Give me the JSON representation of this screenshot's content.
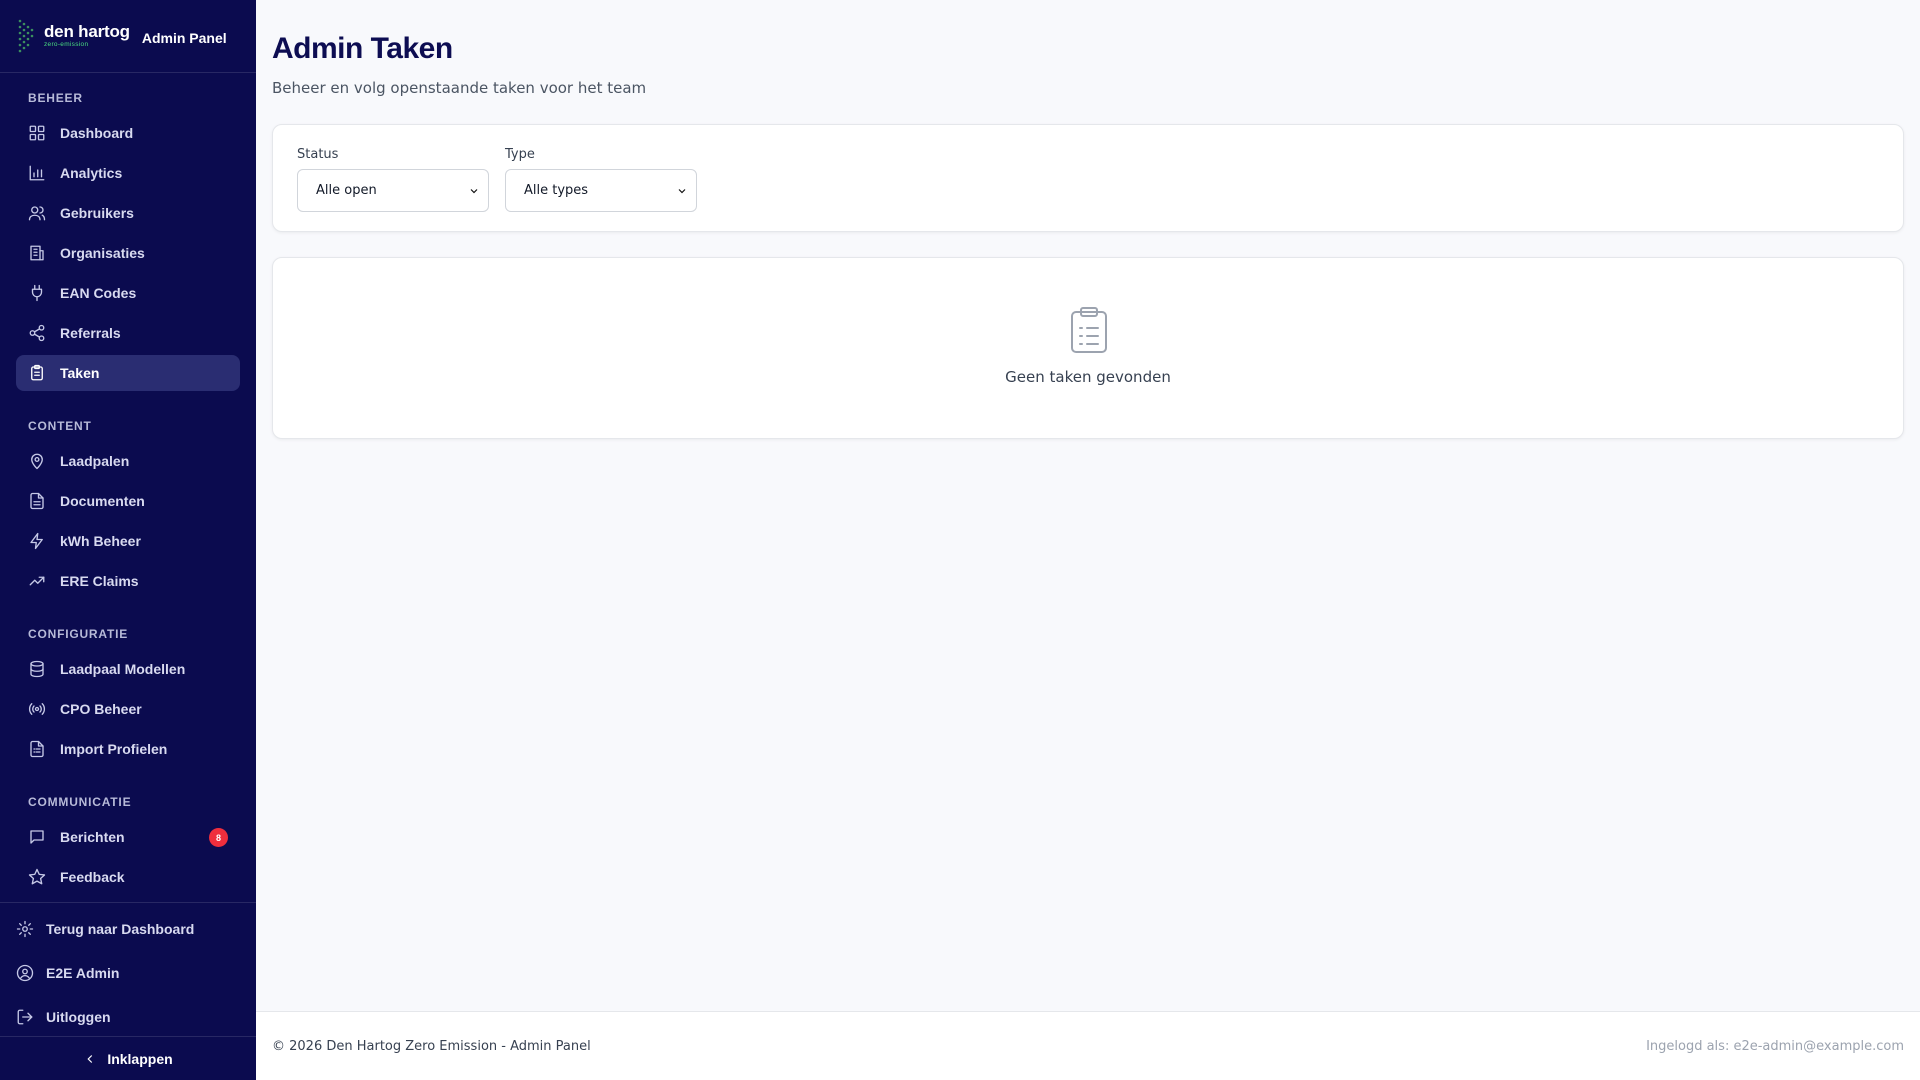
{
  "brand": {
    "name": "den hartog",
    "tagline": "zero-emission",
    "panel": "Admin Panel",
    "accent": "#4ade80"
  },
  "sidebar": {
    "sections": [
      {
        "title": "BEHEER",
        "items": [
          {
            "label": "Dashboard",
            "icon": "grid-icon"
          },
          {
            "label": "Analytics",
            "icon": "bar-chart-icon"
          },
          {
            "label": "Gebruikers",
            "icon": "users-icon"
          },
          {
            "label": "Organisaties",
            "icon": "building-icon"
          },
          {
            "label": "EAN Codes",
            "icon": "plug-icon"
          },
          {
            "label": "Referrals",
            "icon": "share-icon"
          },
          {
            "label": "Taken",
            "icon": "clipboard-icon",
            "active": true
          }
        ]
      },
      {
        "title": "CONTENT",
        "items": [
          {
            "label": "Laadpalen",
            "icon": "map-pin-icon"
          },
          {
            "label": "Documenten",
            "icon": "document-icon"
          },
          {
            "label": "kWh Beheer",
            "icon": "lightning-icon"
          },
          {
            "label": "ERE Claims",
            "icon": "trending-up-icon"
          }
        ]
      },
      {
        "title": "CONFIGURATIE",
        "items": [
          {
            "label": "Laadpaal Modellen",
            "icon": "database-icon"
          },
          {
            "label": "CPO Beheer",
            "icon": "broadcast-icon"
          },
          {
            "label": "Import Profielen",
            "icon": "file-list-icon"
          }
        ]
      },
      {
        "title": "COMMUNICATIE",
        "items": [
          {
            "label": "Berichten",
            "icon": "chat-icon",
            "badge": "8"
          },
          {
            "label": "Feedback",
            "icon": "star-icon"
          }
        ]
      }
    ],
    "bottom": [
      {
        "label": "Terug naar Dashboard",
        "icon": "gear-icon"
      },
      {
        "label": "E2E Admin",
        "icon": "user-circle-icon"
      },
      {
        "label": "Uitloggen",
        "icon": "logout-icon"
      }
    ],
    "collapse_label": "Inklappen"
  },
  "page": {
    "title": "Admin Taken",
    "subtitle": "Beheer en volg openstaande taken voor het team"
  },
  "filters": {
    "status_label": "Status",
    "status_value": "Alle open",
    "type_label": "Type",
    "type_value": "Alle types"
  },
  "empty": {
    "message": "Geen taken gevonden"
  },
  "footer": {
    "left": "© 2026 Den Hartog Zero Emission - Admin Panel",
    "right": "Ingelogd als: e2e-admin@example.com"
  },
  "colors": {
    "sidebar_bg": "#0b0b4f",
    "active_bg": "#2a2d72",
    "badge": "#ef2e3d",
    "title": "#0d0d52"
  }
}
